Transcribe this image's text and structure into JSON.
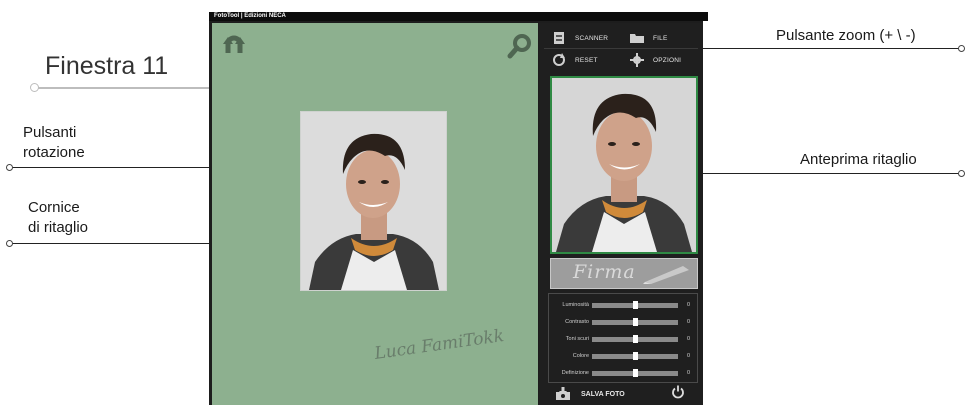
{
  "annotations": {
    "window_label": "Finestra 11",
    "rotation_buttons": [
      "Pulsanti",
      "rotazione"
    ],
    "crop_frame": [
      "Cornice",
      "di ritaglio"
    ],
    "zoom_button": "Pulsante zoom (+ \\ -)",
    "crop_preview": "Anteprima ritaglio"
  },
  "app": {
    "title": "FotoTool  |  Edizioni NECA",
    "menu": {
      "scanner": "SCANNER",
      "file": "FILE",
      "reset": "RESET",
      "options": "OPZIONI"
    },
    "signature_button": "Firma",
    "adjustments": [
      {
        "label": "Luminosità",
        "value": "0",
        "level": 0.5
      },
      {
        "label": "Contrasto",
        "value": "0",
        "level": 0.5
      },
      {
        "label": "Toni scuri",
        "value": "0",
        "level": 0.5
      },
      {
        "label": "Colore",
        "value": "0",
        "level": 0.5
      },
      {
        "label": "Definizione",
        "value": "0",
        "level": 0.5
      }
    ],
    "save_label": "SALVA FOTO",
    "icons": {
      "rotate": "rotate-icon",
      "zoom": "zoom-icon",
      "scanner": "scanner-icon",
      "file": "folder-icon",
      "reset": "reset-icon",
      "options": "gear-icon",
      "save": "save-photo-icon",
      "power": "power-icon"
    },
    "colors": {
      "workspace": "#8db08f",
      "panel": "#1f1f1f",
      "preview_border": "#2f8a44"
    }
  }
}
